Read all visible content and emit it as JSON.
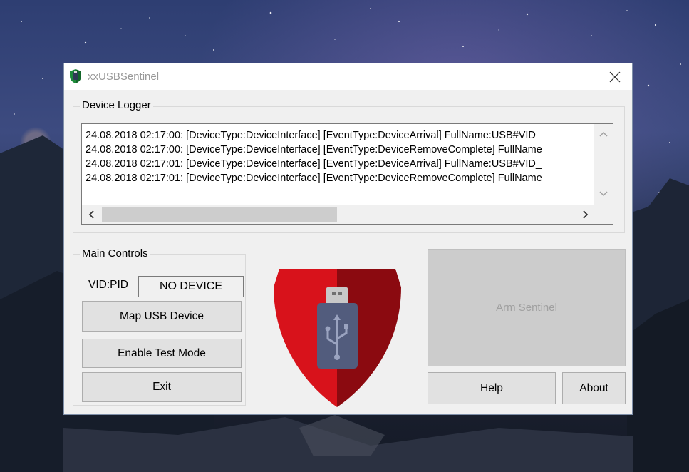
{
  "window": {
    "title": "xxUSBSentinel"
  },
  "device_logger": {
    "label": "Device Logger",
    "lines": [
      "24.08.2018 02:17:00: [DeviceType:DeviceInterface] [EventType:DeviceArrival] FullName:USB#VID_",
      "24.08.2018 02:17:00: [DeviceType:DeviceInterface] [EventType:DeviceRemoveComplete] FullName",
      "24.08.2018 02:17:01: [DeviceType:DeviceInterface] [EventType:DeviceArrival] FullName:USB#VID_",
      "24.08.2018 02:17:01: [DeviceType:DeviceInterface] [EventType:DeviceRemoveComplete] FullName"
    ]
  },
  "main_controls": {
    "label": "Main Controls",
    "vid_pid_label": "VID:PID",
    "vid_pid_value": "NO DEVICE",
    "map_button": "Map USB Device",
    "test_mode_button": "Enable Test Mode",
    "exit_button": "Exit"
  },
  "right_panel": {
    "arm_button": "Arm Sentinel",
    "help_button": "Help",
    "about_button": "About"
  },
  "icons": {
    "app": "shield-usb-icon",
    "close": "close-icon",
    "logo": "usb-shield-logo",
    "scroll_up": "chevron-up-icon",
    "scroll_down": "chevron-down-icon",
    "scroll_left": "chevron-left-icon",
    "scroll_right": "chevron-right-icon"
  },
  "colors": {
    "shield_red": "#d8121b",
    "shield_dark_red": "#8b0a10",
    "usb_body": "#525c7d",
    "window_bg": "#f0f0f0"
  }
}
